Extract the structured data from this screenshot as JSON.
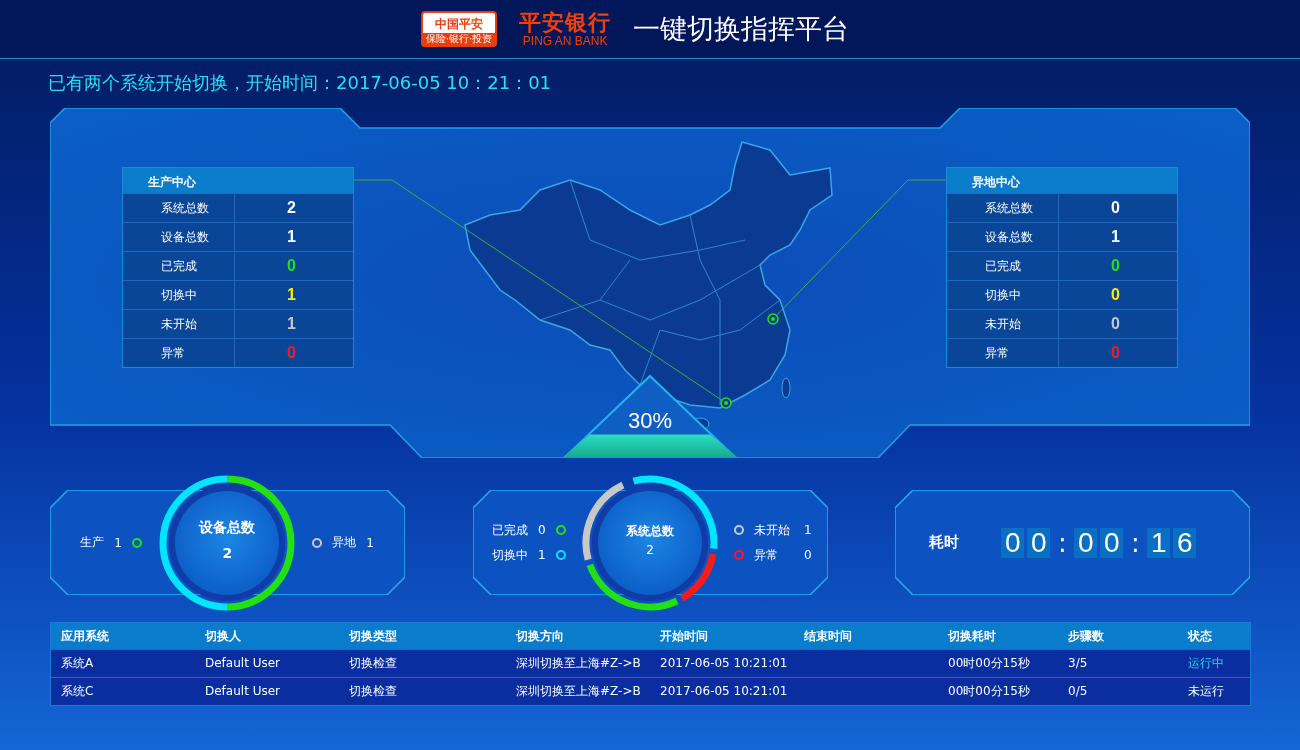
{
  "header": {
    "logo_badge": {
      "name": "中国平安",
      "tagline": "保险·银行·投资"
    },
    "bank_logo": {
      "name": "平安银行",
      "latin": "PING AN BANK"
    },
    "title": "一键切换指挥平台"
  },
  "notice": "已有两个系统开始切换，开始时间：2017-06-05 10：21：01",
  "centers": [
    {
      "title": "生产中心",
      "rows": [
        {
          "label": "系统总数",
          "value": "2",
          "color": "#ffffff"
        },
        {
          "label": "设备总数",
          "value": "1",
          "color": "#ffffff"
        },
        {
          "label": "已完成",
          "value": "0",
          "color": "#22e011"
        },
        {
          "label": "切换中",
          "value": "1",
          "color": "#ffea00"
        },
        {
          "label": "未开始",
          "value": "1",
          "color": "#c8c8c8"
        },
        {
          "label": "异常",
          "value": "0",
          "color": "#ff1a1a"
        }
      ]
    },
    {
      "title": "异地中心",
      "rows": [
        {
          "label": "系统总数",
          "value": "0",
          "color": "#ffffff"
        },
        {
          "label": "设备总数",
          "value": "1",
          "color": "#ffffff"
        },
        {
          "label": "已完成",
          "value": "0",
          "color": "#22e011"
        },
        {
          "label": "切换中",
          "value": "0",
          "color": "#ffea00"
        },
        {
          "label": "未开始",
          "value": "0",
          "color": "#c8c8c8"
        },
        {
          "label": "异常",
          "value": "0",
          "color": "#ff1a1a"
        }
      ]
    }
  ],
  "progress": {
    "label": "30%"
  },
  "gauges": [
    {
      "kind": "device",
      "title": "设备总数",
      "value": "2",
      "segments": [
        {
          "color": "#22e011"
        },
        {
          "color": "#00e5ff"
        }
      ],
      "left": [
        {
          "label": "生产",
          "value": "1",
          "color": "#22e011"
        }
      ],
      "right": [
        {
          "label": "异地",
          "value": "1",
          "color": "#c8c8c8"
        }
      ]
    },
    {
      "kind": "system",
      "title": "系统总数",
      "value": "2",
      "segments": [
        {
          "color": "#22e011"
        },
        {
          "color": "#00e5ff"
        },
        {
          "color": "#c8c8c8"
        },
        {
          "color": "#ff1a1a"
        }
      ],
      "left": [
        {
          "label": "已完成",
          "value": "0",
          "color": "#22e011"
        },
        {
          "label": "切换中",
          "value": "1",
          "color": "#00e5ff"
        }
      ],
      "right": [
        {
          "label": "未开始",
          "value": "1",
          "color": "#c8c8c8"
        },
        {
          "label": "异常",
          "value": "0",
          "color": "#ff1a1a"
        }
      ]
    }
  ],
  "timer": {
    "label": "耗时",
    "digits": [
      {
        "kind": "digit",
        "text": "0"
      },
      {
        "kind": "digit",
        "text": "0"
      },
      {
        "kind": "sep",
        "text": ":"
      },
      {
        "kind": "digit",
        "text": "0"
      },
      {
        "kind": "digit",
        "text": "0"
      },
      {
        "kind": "sep",
        "text": ":"
      },
      {
        "kind": "digit",
        "text": "1"
      },
      {
        "kind": "digit",
        "text": "6"
      }
    ]
  },
  "table": {
    "columns": [
      "应用系统",
      "切换人",
      "切换类型",
      "切换方向",
      "开始时间",
      "结束时间",
      "切换耗时",
      "步骤数",
      "状态"
    ],
    "rows": [
      {
        "cells": [
          "系统A",
          "Default User",
          "切换检查",
          "深圳切换至上海#Z->B",
          "2017-06-05 10:21:01",
          null,
          "00时00分15秒",
          "3/5"
        ],
        "status": {
          "kind": "running",
          "text": "运行中"
        }
      },
      {
        "cells": [
          "系统C",
          "Default User",
          "切换检查",
          "深圳切换至上海#Z->B",
          "2017-06-05 10:21:01",
          null,
          "00时00分15秒",
          "0/5"
        ],
        "status": {
          "kind": "idle",
          "text": "未运行"
        }
      }
    ]
  }
}
